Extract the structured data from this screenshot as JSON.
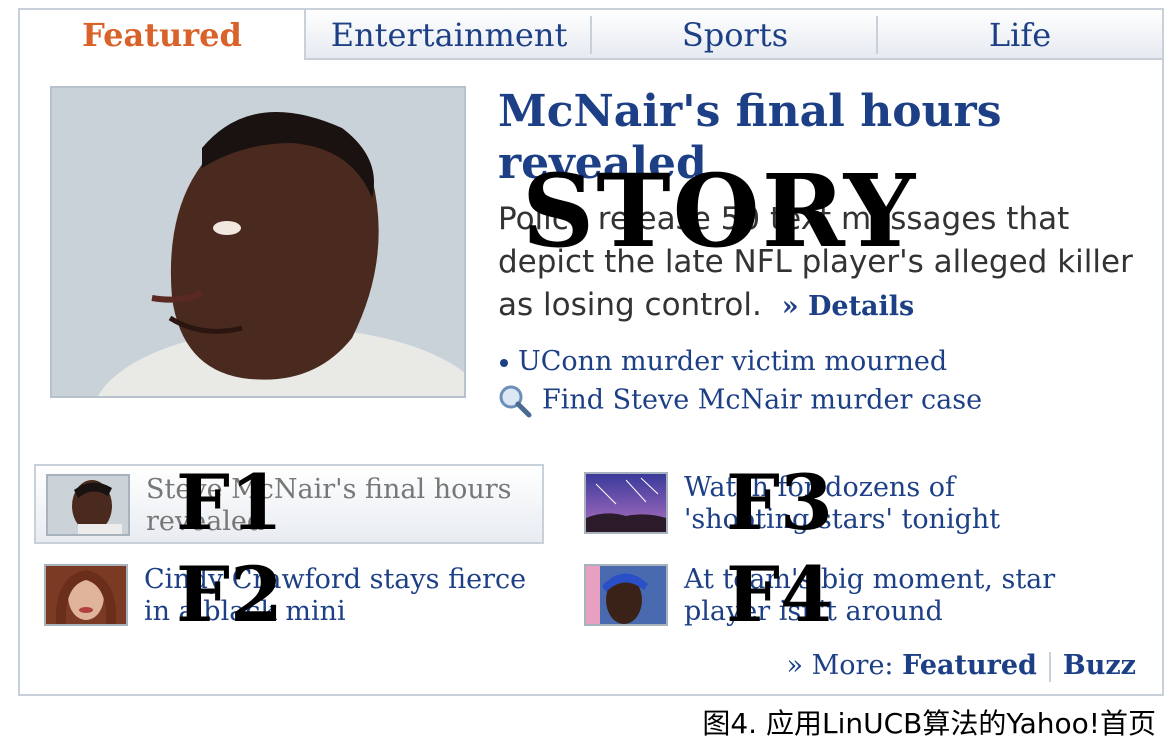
{
  "tabs": [
    {
      "label": "Featured"
    },
    {
      "label": "Entertainment"
    },
    {
      "label": "Sports"
    },
    {
      "label": "Life"
    }
  ],
  "story": {
    "headline": "McNair's final hours revealed",
    "summary": "Police release 50 text messages that depict the late NFL player's alleged killer as losing control.",
    "details_label": "» Details",
    "overlay_label": "STORY"
  },
  "related": {
    "bullet_link": "UConn murder victim mourned",
    "search_link": "Find Steve McNair murder case"
  },
  "features": [
    {
      "id": "F1",
      "text": "Steve McNair's final hours revealed",
      "label": "F1"
    },
    {
      "id": "F2",
      "text": "Cindy Crawford stays fierce in a black mini",
      "label": "F2"
    },
    {
      "id": "F3",
      "text": "Watch for dozens of 'shooting stars' tonight",
      "label": "F3"
    },
    {
      "id": "F4",
      "text": "At team's big moment, star player isn't around",
      "label": "F4"
    }
  ],
  "more": {
    "prefix": "» More:",
    "featured": "Featured",
    "buzz": "Buzz"
  },
  "caption": "图4. 应用LinUCB算法的Yahoo!首页",
  "colors": {
    "link": "#1c3f85",
    "active_tab": "#d9622b",
    "border": "#c8d0da"
  }
}
